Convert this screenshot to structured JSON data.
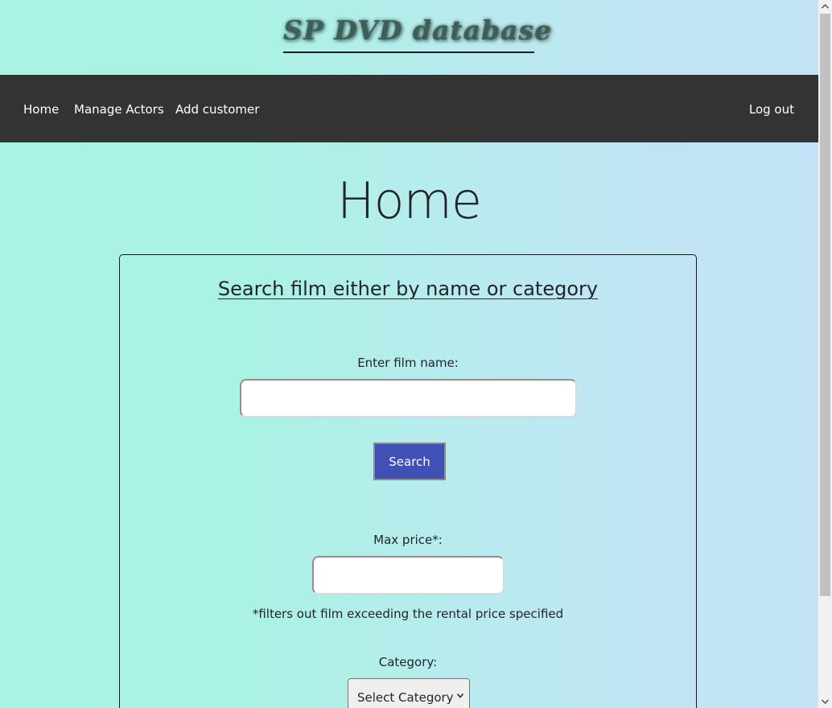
{
  "header": {
    "site_title": "SP DVD database"
  },
  "navbar": {
    "items": [
      {
        "label": "Home"
      },
      {
        "label": "Manage Actors"
      },
      {
        "label": "Add customer"
      }
    ],
    "logout_label": "Log out"
  },
  "main": {
    "page_title": "Home",
    "search_card": {
      "heading": "Search film either by name or category",
      "film_name_label": "Enter film name:",
      "film_name_value": "",
      "search_button_label": "Search",
      "max_price_label": "Max price*:",
      "max_price_value": "",
      "price_note": "*filters out film exceeding the rental price specified",
      "category_label": "Category:",
      "category_selected": "Select Category"
    }
  },
  "icons": {
    "select_arrow": "chevron-down-icon",
    "scroll_up": "scroll-up-arrow-icon",
    "scroll_down": "scroll-down-arrow-icon"
  },
  "colors": {
    "navbar_background": "#333333",
    "search_button": "#3f51b5",
    "background_start": "#a8f3e4",
    "background_end": "#c4e3f6"
  }
}
